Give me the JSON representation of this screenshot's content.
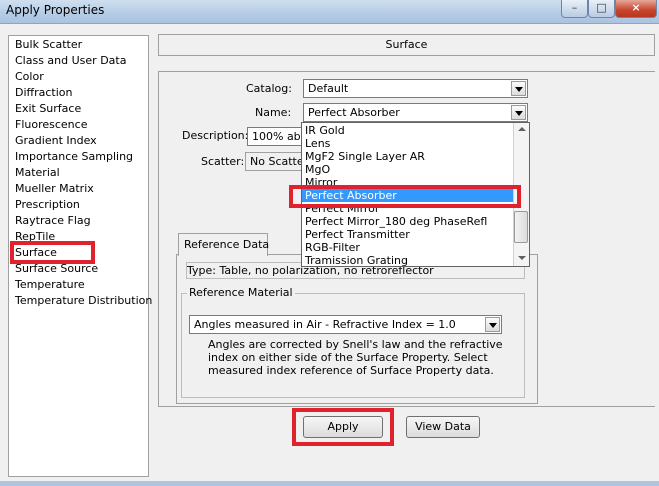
{
  "window": {
    "title": "Apply Properties",
    "buttons": {
      "minimize": "–",
      "maximize": "□",
      "close": "×"
    }
  },
  "categories": [
    "Bulk Scatter",
    "Class and User Data",
    "Color",
    "Diffraction",
    "Exit Surface",
    "Fluorescence",
    "Gradient Index",
    "Importance Sampling",
    "Material",
    "Mueller Matrix",
    "Prescription",
    "Raytrace Flag",
    "RepTile",
    "Surface",
    "Surface Source",
    "Temperature",
    "Temperature Distribution"
  ],
  "selected_category": "Surface",
  "header": {
    "title": "Surface"
  },
  "form": {
    "catalog_label": "Catalog:",
    "catalog_value": "Default",
    "name_label": "Name:",
    "name_value": "Perfect Absorber",
    "description_label": "Description:",
    "description_value": "100% abso",
    "scatter_label": "Scatter:",
    "scatter_value": "No Scatter"
  },
  "name_dropdown": {
    "options": [
      "IR Gold",
      "Lens",
      "MgF2 Single Layer AR",
      "MgO",
      "Mirror",
      "Perfect Absorber",
      "Perfect Mirror",
      "Perfect Mirror_180 deg PhaseRefl",
      "Perfect Transmitter",
      "RGB-Filter",
      "Tramission Grating"
    ],
    "selected": "Perfect Absorber"
  },
  "reference": {
    "tab_label": "Reference Data",
    "type_text": "Type: Table, no polarization, no retroreflector",
    "material_group_label": "Reference Material",
    "material_value": "Angles measured in Air - Refractive Index = 1.0",
    "note_line1": "Angles are corrected by Snell's law and the refractive",
    "note_line2": "index on either side of the Surface Property.  Select",
    "note_line3": "measured index reference of Surface Property data."
  },
  "actions": {
    "apply_label": "Apply",
    "view_label": "View Data"
  },
  "colors": {
    "highlight": "#3399ff",
    "annotation": "#e0212e"
  }
}
